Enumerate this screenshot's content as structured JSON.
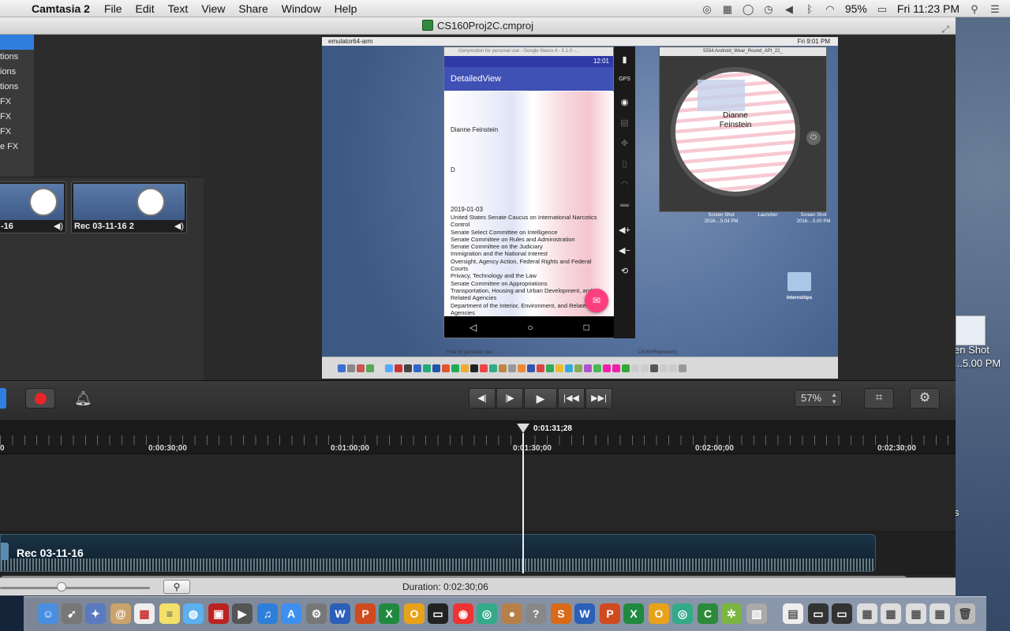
{
  "menubar": {
    "app_name": "Camtasia 2",
    "menus": [
      "File",
      "Edit",
      "Text",
      "View",
      "Share",
      "Window",
      "Help"
    ],
    "battery": "95%",
    "clock": "Fri 11:23 PM"
  },
  "window": {
    "title": "CS160Proj2C.cmproj"
  },
  "left_panel": {
    "tools": [
      "tions",
      "ions",
      "tions",
      "FX",
      "FX",
      "FX",
      "e FX"
    ],
    "clips": [
      {
        "label": "-16"
      },
      {
        "label": "Rec 03-11-16 2"
      }
    ]
  },
  "preview": {
    "inner_menubar_app": "emulator64-arm",
    "inner_clock": "Fri 9:01 PM",
    "android": {
      "window_title": "Genymotion for personal use - Google Nexus 4 - 5.1.0 -...",
      "time": "12:01",
      "app_title": "DetailedView",
      "name": "Dianne Feinstein",
      "party": "D",
      "date": "2019-01-03",
      "committees": [
        "United States Senate Caucus on International Narcotics Control",
        "Senate Select Committee on Intelligence",
        "Senate Committee on Rules and Administration",
        "Senate Committee on the Judiciary",
        "Immigration and the National Interest",
        "Oversight, Agency Action, Federal Rights and Federal Courts",
        "Privacy, Technology and the Law",
        "Senate Committee on Appropriations",
        "Transportation, Housing and Urban Development, and Related Agencies",
        "Department of the Interior, Environment, and Related Agencies"
      ],
      "free_label": "Free for personal use"
    },
    "wear": {
      "window_title": "5554:Android_Wear_Round_API_22_",
      "name_line1": "Dianne",
      "name_line2": "Feinstein"
    },
    "desktop_labels": [
      {
        "line1": "Screen Shot",
        "line2": "2016-...5.04 PM"
      },
      {
        "line1": "Launcher",
        "line2": ""
      },
      {
        "line1": "Screen Shot",
        "line2": "2016-...5.00 PM"
      }
    ],
    "folder_label": "Internships",
    "path_label": "CS160/Represent)"
  },
  "toolbar": {
    "zoom_value": "57%"
  },
  "timeline": {
    "playhead": "0:01:31;28",
    "ruler": [
      "0",
      "0:00:30;00",
      "0:01:00;00",
      "0:01:30;00",
      "0:02:00;00",
      "0:02:30;00"
    ],
    "clip_label": "Rec 03-11-16"
  },
  "statusbar": {
    "duration": "Duration: 0:02:30;06"
  },
  "desktop_right": {
    "label1": "en Shot",
    "label2": "...5.00 PM",
    "label3": "s"
  },
  "dock": {
    "icons": [
      "finder",
      "launchpad",
      "preview",
      "contacts",
      "calendar",
      "notes",
      "messages",
      "photo-booth",
      "facetime",
      "itunes",
      "app-store",
      "system-preferences",
      "word",
      "powerpoint",
      "excel",
      "outlook",
      "terminal",
      "chrome",
      "safari",
      "mail",
      "help",
      "sublime",
      "word",
      "powerpoint",
      "excel",
      "outlook",
      "safari",
      "android-studio",
      "camtasia",
      "image-capture",
      "document",
      "terminal-doc",
      "terminal-doc",
      "screenshot",
      "screenshot",
      "screenshot",
      "screenshot",
      "trash"
    ]
  }
}
